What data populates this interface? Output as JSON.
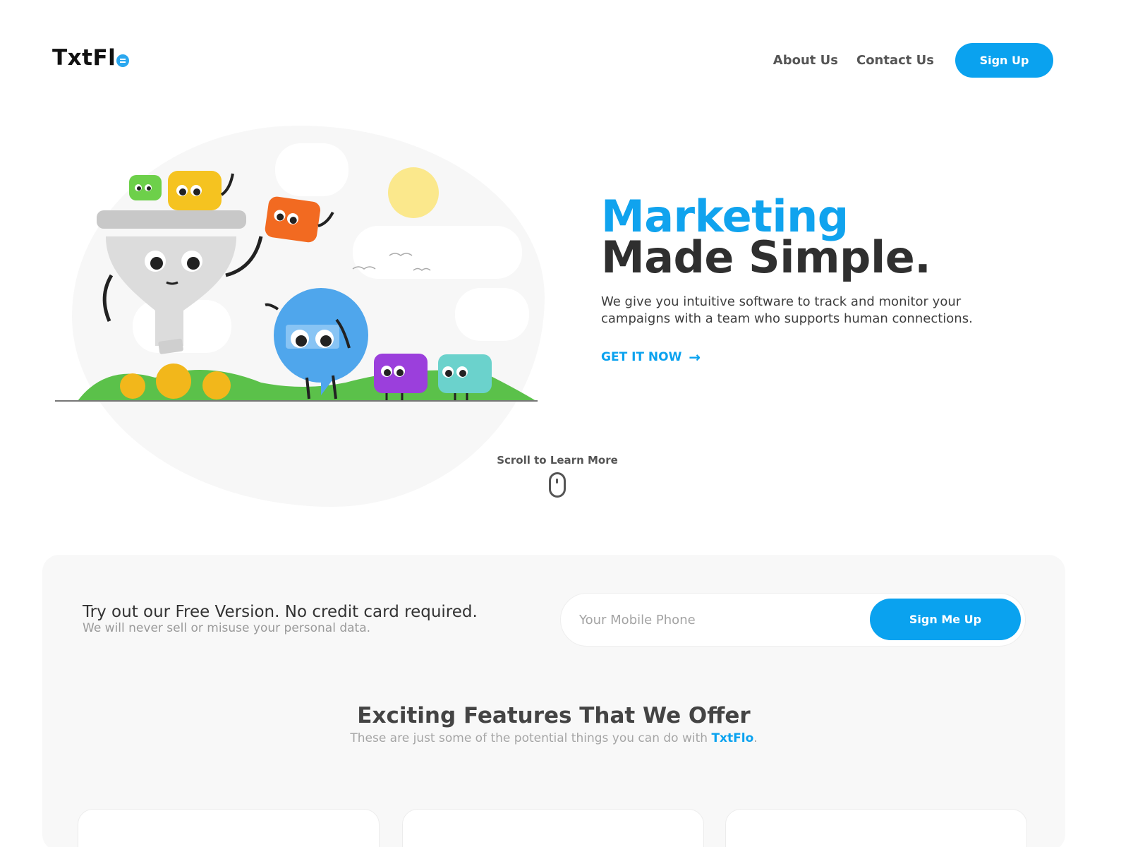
{
  "header": {
    "logo_text": "TxtFl",
    "nav": {
      "about_label": "About Us",
      "contact_label": "Contact Us",
      "signup_label": "Sign Up"
    }
  },
  "hero": {
    "title_line1": "Marketing",
    "title_line2": "Made Simple.",
    "description": "We give you intuitive software to track and monitor your campaigns with a team who supports human connections.",
    "cta_label": "GET IT NOW",
    "cta_icon": "arrow-right-icon"
  },
  "scroll_hint": {
    "label": "Scroll to Learn More",
    "icon": "mouse-icon"
  },
  "trial": {
    "title": "Try out our Free Version. No credit card required.",
    "subtitle": "We will never sell or misuse your personal data.",
    "phone_placeholder": "Your Mobile Phone",
    "submit_label": "Sign Me Up"
  },
  "features": {
    "title": "Exciting Features That We Offer",
    "subtitle_prefix": "These are just some of the potential things you can do with ",
    "subtitle_brand": "TxtFlo",
    "subtitle_suffix": "."
  },
  "colors": {
    "accent": "#0aa2ef",
    "heading": "#2f2f2f",
    "panel": "#f8f8f8"
  }
}
